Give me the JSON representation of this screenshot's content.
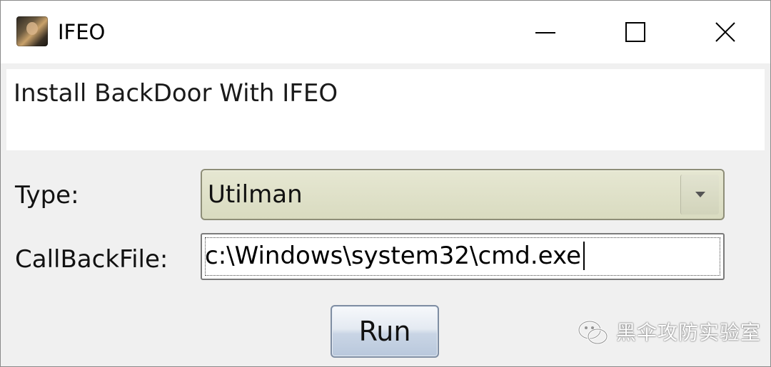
{
  "window": {
    "title": "IFEO",
    "app_icon": "app-photo-icon",
    "controls": {
      "minimize_icon": "minimize-icon",
      "maximize_icon": "maximize-icon",
      "close_icon": "close-icon"
    }
  },
  "header": {
    "text": "Install BackDoor With IFEO"
  },
  "form": {
    "type_label": "Type:",
    "type_value": "Utilman",
    "callback_label": "CallBackFile:",
    "callback_value": "c:\\Windows\\system32\\cmd.exe",
    "run_label": "Run"
  },
  "watermark": {
    "icon": "wechat-icon",
    "text": "黑伞攻防实验室"
  },
  "colors": {
    "combo_background": "#dcdcc4",
    "window_background": "#f0f0f0",
    "button_gradient_bottom": "#b9c8dc"
  }
}
